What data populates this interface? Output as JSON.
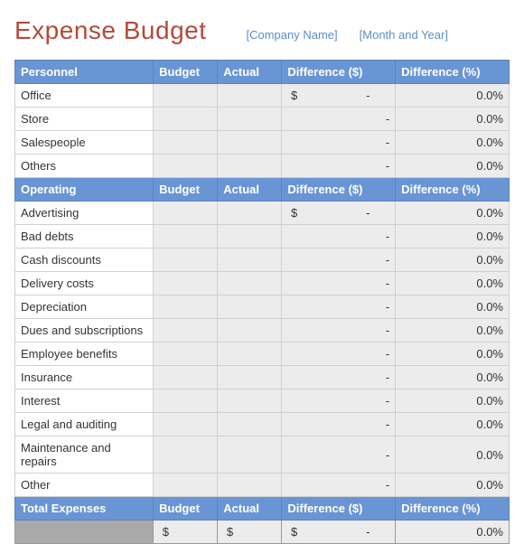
{
  "header": {
    "title": "Expense Budget",
    "company_placeholder": "[Company Name]",
    "date_placeholder": "[Month and Year]"
  },
  "columns": {
    "budget": "Budget",
    "actual": "Actual",
    "diff_dollar": "Difference ($)",
    "diff_pct": "Difference (%)"
  },
  "sections": [
    {
      "name": "Personnel",
      "rows": [
        {
          "label": "Office",
          "budget": "",
          "actual": "",
          "diff_dollar": " $                     -",
          "diff_pct": "0.0%"
        },
        {
          "label": "Store",
          "budget": "",
          "actual": "",
          "diff_dollar": "-",
          "diff_pct": "0.0%"
        },
        {
          "label": "Salespeople",
          "budget": "",
          "actual": "",
          "diff_dollar": "-",
          "diff_pct": "0.0%"
        },
        {
          "label": "Others",
          "budget": "",
          "actual": "",
          "diff_dollar": "-",
          "diff_pct": "0.0%"
        }
      ]
    },
    {
      "name": "Operating",
      "rows": [
        {
          "label": "Advertising",
          "budget": "",
          "actual": "",
          "diff_dollar": " $                     -",
          "diff_pct": "0.0%"
        },
        {
          "label": "Bad debts",
          "budget": "",
          "actual": "",
          "diff_dollar": "-",
          "diff_pct": "0.0%"
        },
        {
          "label": "Cash discounts",
          "budget": "",
          "actual": "",
          "diff_dollar": "-",
          "diff_pct": "0.0%"
        },
        {
          "label": "Delivery costs",
          "budget": "",
          "actual": "",
          "diff_dollar": "-",
          "diff_pct": "0.0%"
        },
        {
          "label": "Depreciation",
          "budget": "",
          "actual": "",
          "diff_dollar": "-",
          "diff_pct": "0.0%"
        },
        {
          "label": "Dues and subscriptions",
          "budget": "",
          "actual": "",
          "diff_dollar": "-",
          "diff_pct": "0.0%"
        },
        {
          "label": "Employee benefits",
          "budget": "",
          "actual": "",
          "diff_dollar": "-",
          "diff_pct": "0.0%"
        },
        {
          "label": "Insurance",
          "budget": "",
          "actual": "",
          "diff_dollar": "-",
          "diff_pct": "0.0%"
        },
        {
          "label": "Interest",
          "budget": "",
          "actual": "",
          "diff_dollar": "-",
          "diff_pct": "0.0%"
        },
        {
          "label": "Legal and auditing",
          "budget": "",
          "actual": "",
          "diff_dollar": "-",
          "diff_pct": "0.0%"
        },
        {
          "label": "Maintenance and repairs",
          "budget": "",
          "actual": "",
          "diff_dollar": "-",
          "diff_pct": "0.0%"
        },
        {
          "label": "Other",
          "budget": "",
          "actual": "",
          "diff_dollar": "-",
          "diff_pct": "0.0%"
        }
      ]
    }
  ],
  "totals": {
    "label": "Total  Expenses",
    "row": {
      "label": "",
      "budget": " $",
      "actual": " $",
      "diff_dollar": " $                     -",
      "diff_pct": "0.0%"
    }
  }
}
